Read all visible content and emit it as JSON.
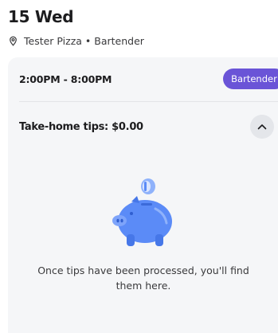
{
  "header": {
    "date_title": "15 Wed",
    "location": "Tester Pizza • Bartender",
    "location_icon": "location-pin-icon"
  },
  "shift": {
    "time_range": "2:00PM - 8:00PM",
    "role_badge": "Bartender",
    "badge_color": "#6a54d7"
  },
  "tips": {
    "label": "Take-home tips: $0.00",
    "toggle_icon": "chevron-up-icon",
    "illustration": "piggy-bank-coin-illustration",
    "empty_message": "Once tips have been processed, you'll find them here.",
    "illustration_color": "#5b8bf7"
  }
}
